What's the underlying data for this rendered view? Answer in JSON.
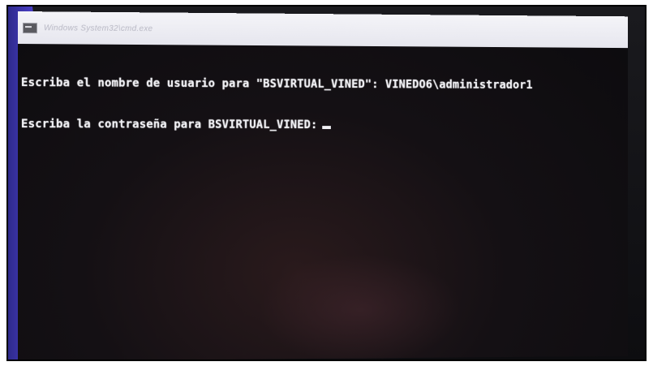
{
  "window": {
    "title": "Windows System32\\cmd.exe",
    "icon": "console-icon"
  },
  "terminal": {
    "lines": [
      "Escriba el nombre de usuario para \"BSVIRTUAL_VINED\": VINEDO6\\administrador1",
      "Escriba la contraseña para BSVIRTUAL_VINED:"
    ]
  },
  "colors": {
    "background": "#0c0b0e",
    "text": "#f0f0f4",
    "titlebar": "#f4f4f8",
    "side_accent": "#4a3fc9"
  }
}
